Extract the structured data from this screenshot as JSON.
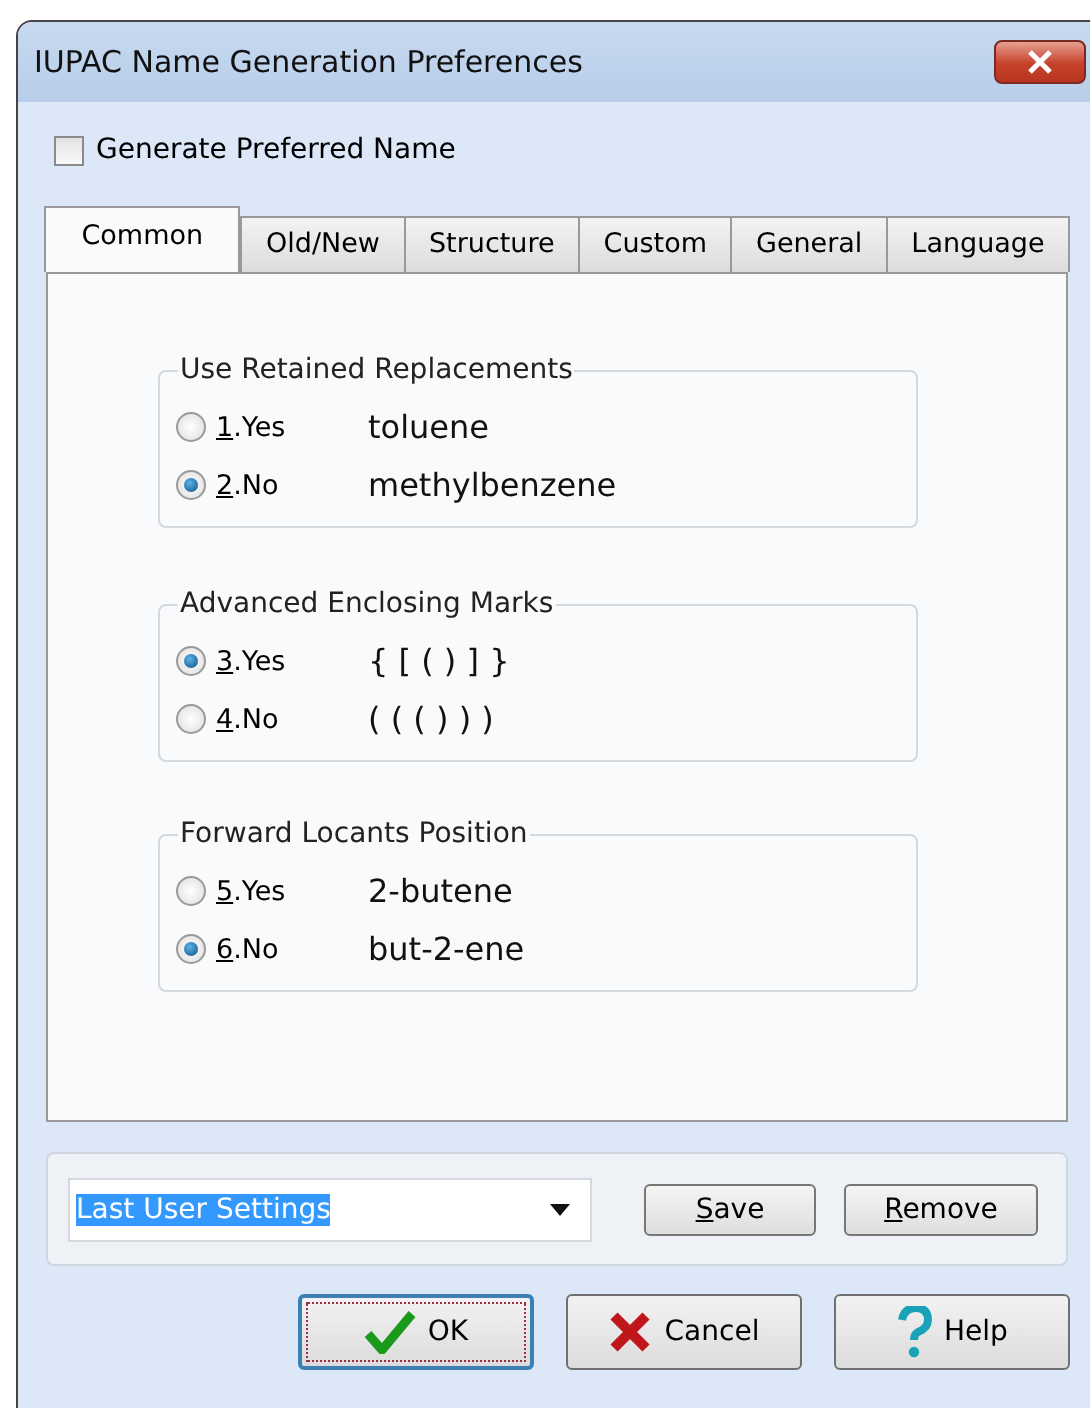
{
  "window": {
    "title": "IUPAC Name Generation Preferences"
  },
  "generate_preferred": {
    "label": "Generate Preferred Name",
    "checked": false
  },
  "tabs": [
    {
      "label": "Common",
      "selected": true
    },
    {
      "label": "Old/New",
      "selected": false
    },
    {
      "label": "Structure",
      "selected": false
    },
    {
      "label": "Custom",
      "selected": false
    },
    {
      "label": "General",
      "selected": false
    },
    {
      "label": "Language",
      "selected": false
    }
  ],
  "groups": [
    {
      "title": "Use Retained Replacements",
      "options": [
        {
          "label": "1.Yes",
          "example": "toluene",
          "selected": false
        },
        {
          "label": "2.No",
          "example": "methylbenzene",
          "selected": true
        }
      ]
    },
    {
      "title": "Advanced Enclosing Marks",
      "options": [
        {
          "label": "3.Yes",
          "example": "{ [ ( ) ] }",
          "selected": true
        },
        {
          "label": "4.No",
          "example": "( ( ( ) ) )",
          "selected": false
        }
      ]
    },
    {
      "title": "Forward Locants Position",
      "options": [
        {
          "label": "5.Yes",
          "example": "2-butene",
          "selected": false
        },
        {
          "label": "6.No",
          "example": "but-2-ene",
          "selected": true
        }
      ]
    }
  ],
  "preset": {
    "value": "Last User Settings",
    "highlighted": true
  },
  "preset_buttons": [
    {
      "label": "Save"
    },
    {
      "label": "Remove"
    }
  ],
  "buttons": [
    {
      "label": "OK",
      "kind": "confirm",
      "default": true
    },
    {
      "label": "Cancel",
      "kind": "cancel",
      "default": false
    },
    {
      "label": "Help",
      "kind": "help",
      "default": false
    }
  ]
}
